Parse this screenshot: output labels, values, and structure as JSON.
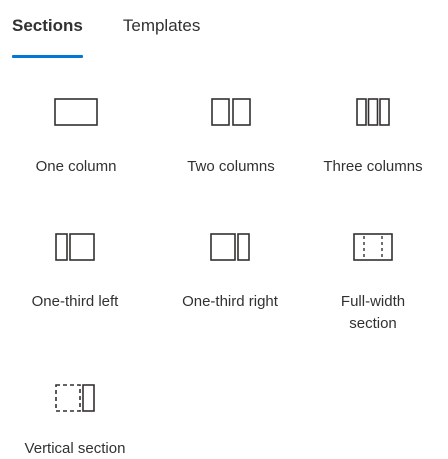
{
  "tabs": [
    {
      "label": "Sections",
      "active": true
    },
    {
      "label": "Templates",
      "active": false
    }
  ],
  "accent_color": "#0078d4",
  "sections": [
    {
      "label": "One column",
      "icon": "one-column-icon"
    },
    {
      "label": "Two columns",
      "icon": "two-columns-icon"
    },
    {
      "label": "Three columns",
      "icon": "three-columns-icon"
    },
    {
      "label": "One-third left",
      "icon": "one-third-left-icon"
    },
    {
      "label": "One-third right",
      "icon": "one-third-right-icon"
    },
    {
      "label": "Full-width section",
      "icon": "full-width-section-icon"
    },
    {
      "label": "Vertical section",
      "icon": "vertical-section-icon"
    }
  ]
}
